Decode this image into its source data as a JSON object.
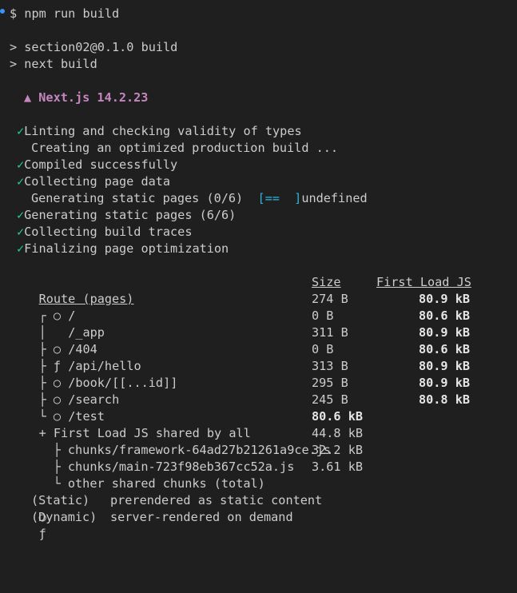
{
  "prompt": {
    "symbol": "$",
    "command": "npm run build"
  },
  "script_lines": [
    "> section02@0.1.0 build",
    "> next build"
  ],
  "next_banner": "▲ Next.js 14.2.23",
  "check_mark": "✓",
  "steps": [
    {
      "done": true,
      "text": "Linting and checking validity of types"
    },
    {
      "done": false,
      "text": "Creating an optimized production build ..."
    },
    {
      "done": true,
      "text": "Compiled successfully"
    },
    {
      "done": true,
      "text": "Collecting page data"
    },
    {
      "done": false,
      "text": "Generating static pages (0/6)",
      "progress_bar": "[==  ]",
      "suffix": "undefined"
    },
    {
      "done": true,
      "text": "Generating static pages (6/6)"
    },
    {
      "done": true,
      "text": "Collecting build traces"
    },
    {
      "done": true,
      "text": "Finalizing page optimization"
    }
  ],
  "table": {
    "headers": {
      "route": "Route (pages)",
      "size": "Size",
      "first_load": "First Load JS"
    },
    "rows": [
      {
        "tree": "┌",
        "type": "○",
        "route": "/",
        "size": "274 B",
        "first_load": "80.9 kB"
      },
      {
        "tree": "│",
        "type": " ",
        "route": "/_app",
        "size": "0 B",
        "first_load": "80.6 kB"
      },
      {
        "tree": "├",
        "type": "○",
        "route": "/404",
        "size": "311 B",
        "first_load": "80.9 kB"
      },
      {
        "tree": "├",
        "type": "ƒ",
        "route": "/api/hello",
        "size": "0 B",
        "first_load": "80.6 kB"
      },
      {
        "tree": "├",
        "type": "○",
        "route": "/book/[[...id]]",
        "size": "313 B",
        "first_load": "80.9 kB"
      },
      {
        "tree": "├",
        "type": "○",
        "route": "/search",
        "size": "295 B",
        "first_load": "80.9 kB"
      },
      {
        "tree": "└",
        "type": "○",
        "route": "/test",
        "size": "245 B",
        "first_load": "80.8 kB"
      }
    ],
    "shared": {
      "label": "+ First Load JS shared by all",
      "size": "80.6 kB",
      "chunks": [
        {
          "tree": "├",
          "name": "chunks/framework-64ad27b21261a9ce.js",
          "size": "44.8 kB"
        },
        {
          "tree": "├",
          "name": "chunks/main-723f98eb367cc52a.js",
          "size": "32.2 kB"
        },
        {
          "tree": "└",
          "name": "other shared chunks (total)",
          "size": "3.61 kB"
        }
      ]
    }
  },
  "legend": [
    {
      "symbol": "○",
      "kind": "(Static)",
      "desc": "prerendered as static content"
    },
    {
      "symbol": "ƒ",
      "kind": "(Dynamic)",
      "desc": "server-rendered on demand"
    }
  ],
  "colors": {
    "background": "#1f1f1f",
    "text": "#cccccc",
    "check": "#23d18b",
    "nextjs": "#c586c0",
    "progress": "#29b8db",
    "prompt_dot": "#3794ff"
  }
}
